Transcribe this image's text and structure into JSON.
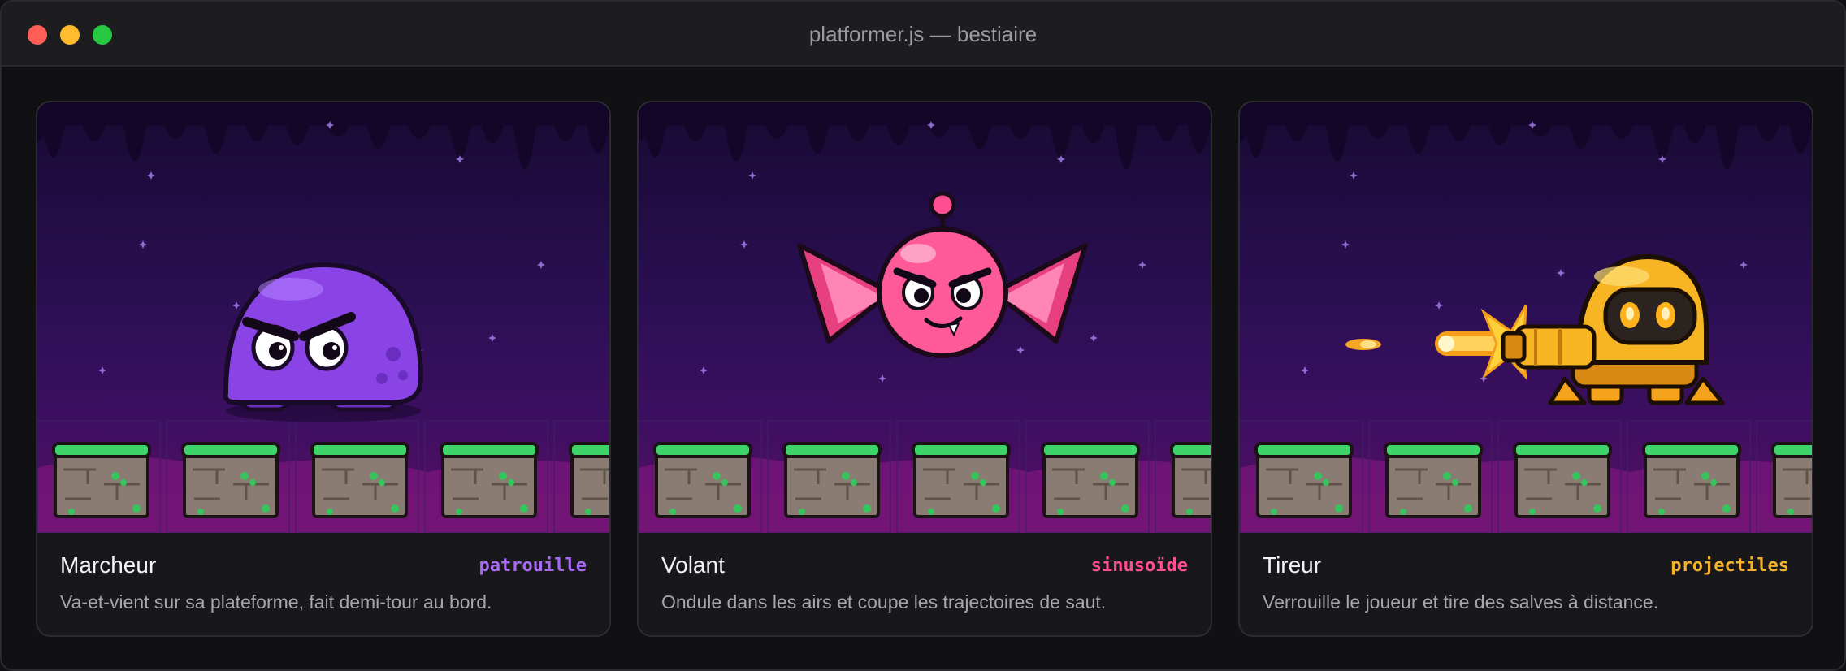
{
  "window": {
    "title": "platformer.js — bestiaire"
  },
  "cards": [
    {
      "name": "Marcheur",
      "tag": "patrouille",
      "description": "Va-et-vient sur sa plateforme, fait demi-tour au bord.",
      "accent": "#a66bf2",
      "icon": "purple-blob-enemy-icon"
    },
    {
      "name": "Volant",
      "tag": "sinusoïde",
      "description": "Ondule dans les airs et coupe les trajectoires de saut.",
      "accent": "#ff4f91",
      "icon": "pink-bat-enemy-icon"
    },
    {
      "name": "Tireur",
      "tag": "projectiles",
      "description": "Verrouille le joueur et tire des salves à distance.",
      "accent": "#f5b02c",
      "icon": "yellow-turret-enemy-icon"
    }
  ]
}
